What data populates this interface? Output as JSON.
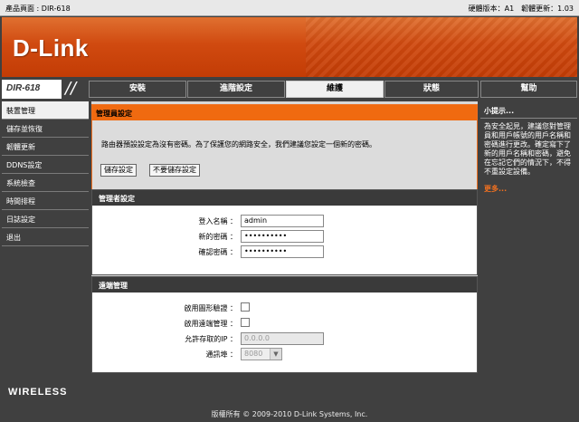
{
  "topbar": {
    "product": "產品頁面 : DIR-618",
    "versions": "硬體版本：A1　韌體更新：1.03"
  },
  "logo": "D-Link",
  "model": "DIR-618",
  "tabs": [
    {
      "label": "安裝",
      "active": false
    },
    {
      "label": "進階設定",
      "active": false
    },
    {
      "label": "維護",
      "active": true
    },
    {
      "label": "狀態",
      "active": false
    },
    {
      "label": "幫助",
      "active": false
    }
  ],
  "sidebar": [
    {
      "label": "裝置管理",
      "active": true
    },
    {
      "label": "儲存並恢復",
      "active": false
    },
    {
      "label": "韌體更新",
      "active": false
    },
    {
      "label": "DDNS設定",
      "active": false
    },
    {
      "label": "系統檢查",
      "active": false
    },
    {
      "label": "時間排程",
      "active": false
    },
    {
      "label": "日誌設定",
      "active": false
    },
    {
      "label": "退出",
      "active": false
    }
  ],
  "admin_box": {
    "title": "管理員設定",
    "message": "路由器預設設定為沒有密碼。為了保護您的網路安全，我們建議您設定一個新的密碼。",
    "save_label": "儲存設定",
    "dont_save_label": "不要儲存設定"
  },
  "manager": {
    "title": "管理者設定",
    "login_label": "登入名稱 ：",
    "login_value": "admin",
    "new_pw_label": "新的密碼 ：",
    "new_pw_value": "••••••••••",
    "confirm_pw_label": "確認密碼 ：",
    "confirm_pw_value": "••••••••••"
  },
  "remote": {
    "title": "遠端管理",
    "captcha_label": "啟用圖形驗證 ：",
    "remote_label": "啟用遠端管理 ：",
    "allowed_ip_label": "允許存取的IP ：",
    "allowed_ip_value": "0.0.0.0",
    "port_label": "通訊埠 ：",
    "port_value": "8080"
  },
  "help": {
    "title": "小提示...",
    "body": "為安全起見，建議您對管理員和用戶帳號的用戶名稱和密碼進行更改。確定寫下了新的用戶名稱和密碼，避免在忘記它們的情況下，不得不重設定設備。",
    "more": "更多..."
  },
  "footer": {
    "brand": "WIRELESS",
    "copyright": "版權所有 © 2009-2010 D-Link Systems, Inc."
  }
}
